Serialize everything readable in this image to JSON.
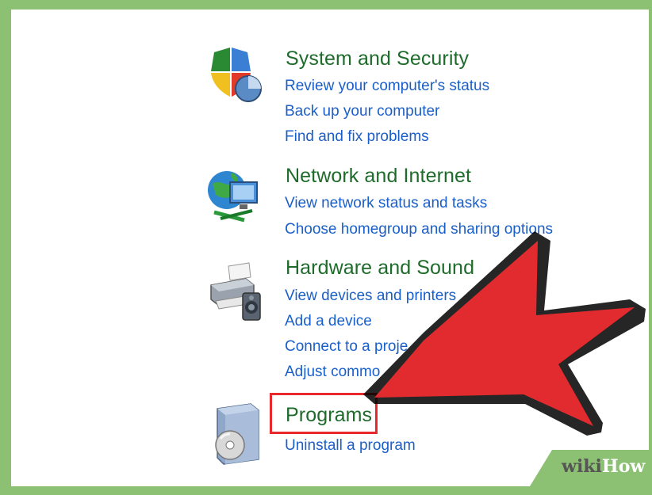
{
  "categories": [
    {
      "title": "System and Security",
      "links": [
        "Review your computer's status",
        "Back up your computer",
        "Find and fix problems"
      ]
    },
    {
      "title": "Network and Internet",
      "links": [
        "View network status and tasks",
        "Choose homegroup and sharing options"
      ]
    },
    {
      "title": "Hardware and Sound",
      "links": [
        "View devices and printers",
        "Add a device",
        "Connect to a proje",
        "Adjust commo"
      ]
    },
    {
      "title": "Programs",
      "links": [
        "Uninstall a program"
      ]
    }
  ],
  "watermark": {
    "wiki": "wiki",
    "how": "How"
  },
  "colors": {
    "frame": "#8cc173",
    "title": "#1e6b2b",
    "link": "#1a5fc9",
    "arrow": "#e22b2e",
    "highlight": "#e8282b"
  },
  "icons": [
    "shield-icon",
    "network-icon",
    "printer-icon",
    "programs-icon",
    "arrow-pointer"
  ]
}
